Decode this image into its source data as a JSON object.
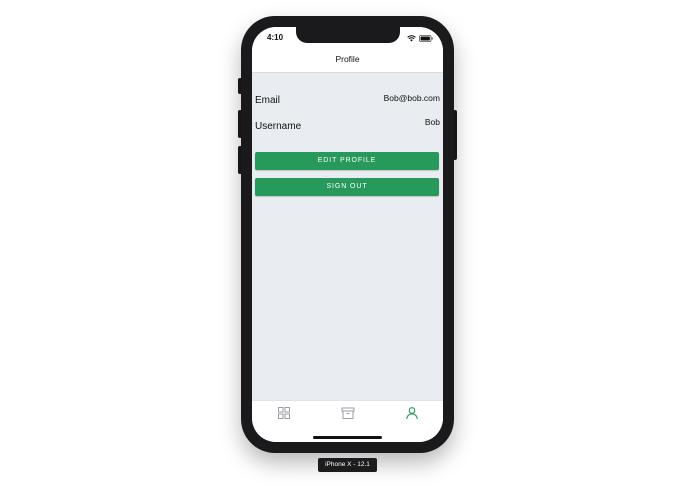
{
  "status_bar": {
    "time": "4:10",
    "icons": [
      "wifi-icon",
      "battery-icon"
    ]
  },
  "header": {
    "title": "Profile"
  },
  "profile": {
    "fields": [
      {
        "label": "Email",
        "value": "Bob@bob.com"
      },
      {
        "label": "Username",
        "value": "Bob"
      }
    ]
  },
  "actions": {
    "edit_label": "EDIT PROFILE",
    "signout_label": "SIGN OUT"
  },
  "tab_bar": {
    "tabs": [
      {
        "icon": "grid-icon",
        "active": false
      },
      {
        "icon": "archive-icon",
        "active": false
      },
      {
        "icon": "user-icon",
        "active": true
      }
    ]
  },
  "device": {
    "label": "iPhone X - 12.1"
  },
  "colors": {
    "accent": "#27995a",
    "background": "#e9edf1",
    "tab_inactive": "#9a9ea6",
    "tab_active": "#27995a"
  }
}
